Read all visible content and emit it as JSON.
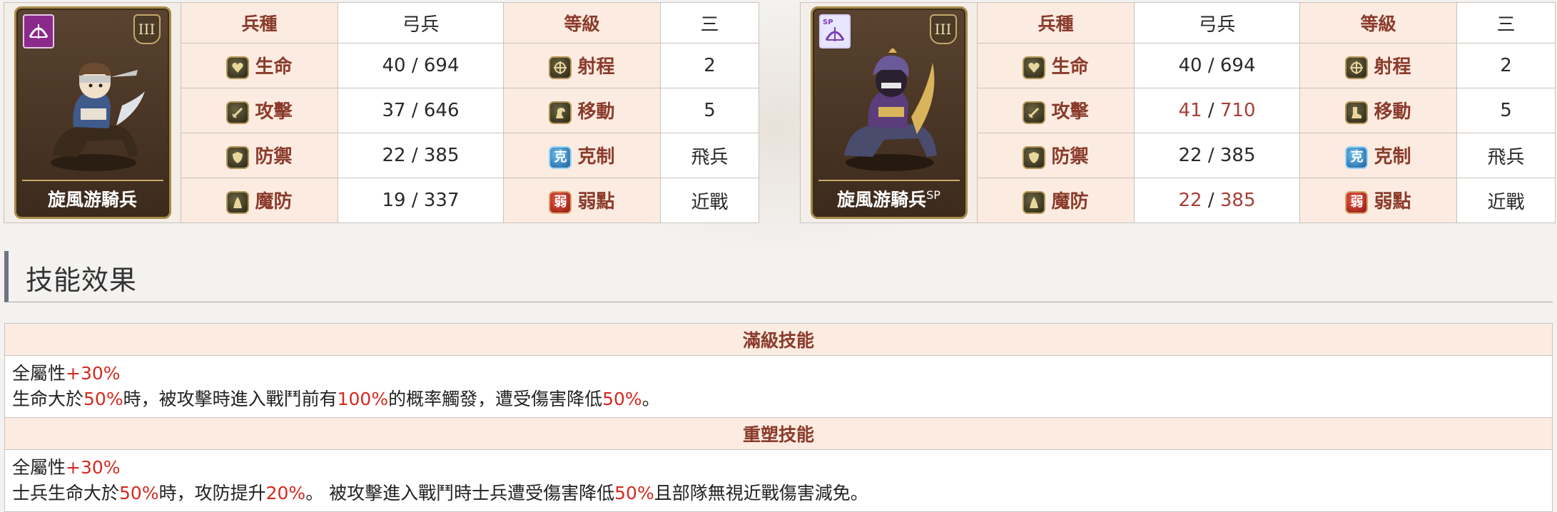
{
  "colors": {
    "header_bg": "#fcebe0",
    "header_text": "#8a3b2b",
    "highlight_red": "#d42a1f",
    "changed_value": "#a4403a"
  },
  "units": [
    {
      "name": "旋風游騎兵",
      "name_suffix": "",
      "rank": "III",
      "portrait_icon": "cavalry-archer-portrait",
      "troop_type_label": "兵種",
      "troop_type": "弓兵",
      "grade_label": "等級",
      "grade": "三",
      "stats": {
        "hp": {
          "label": "生命",
          "icon": "heart-icon",
          "base": "40",
          "max": "694",
          "changed": false
        },
        "atk": {
          "label": "攻擊",
          "icon": "sword-icon",
          "base": "37",
          "max": "646",
          "changed": false
        },
        "def": {
          "label": "防禦",
          "icon": "shield-icon",
          "base": "22",
          "max": "385",
          "changed": false
        },
        "mdef": {
          "label": "魔防",
          "icon": "cloak-icon",
          "base": "19",
          "max": "337",
          "changed": false
        }
      },
      "side": {
        "range": {
          "label": "射程",
          "icon": "crosshair-icon",
          "value": "2"
        },
        "move": {
          "label": "移動",
          "icon": "horse-icon",
          "value": "5"
        },
        "counter": {
          "label": "克制",
          "icon": "counter-icon",
          "glyph": "克",
          "value": "飛兵"
        },
        "weakness": {
          "label": "弱點",
          "icon": "weakness-icon",
          "glyph": "弱",
          "value": "近戰"
        }
      }
    },
    {
      "name": "旋風游騎兵",
      "name_suffix": "SP",
      "rank": "III",
      "portrait_icon": "sp-cavalry-archer-portrait",
      "troop_type_label": "兵種",
      "troop_type": "弓兵",
      "grade_label": "等級",
      "grade": "三",
      "stats": {
        "hp": {
          "label": "生命",
          "icon": "heart-icon",
          "base": "40",
          "max": "694",
          "changed": false
        },
        "atk": {
          "label": "攻擊",
          "icon": "sword-icon",
          "base": "41",
          "max": "710",
          "changed": true
        },
        "def": {
          "label": "防禦",
          "icon": "shield-icon",
          "base": "22",
          "max": "385",
          "changed": false
        },
        "mdef": {
          "label": "魔防",
          "icon": "cloak-icon",
          "base": "22",
          "max": "385",
          "changed": true
        }
      },
      "side": {
        "range": {
          "label": "射程",
          "icon": "crosshair-icon",
          "value": "2"
        },
        "move": {
          "label": "移動",
          "icon": "boot-icon",
          "value": "5"
        },
        "counter": {
          "label": "克制",
          "icon": "counter-icon",
          "glyph": "克",
          "value": "飛兵"
        },
        "weakness": {
          "label": "弱點",
          "icon": "weakness-icon",
          "glyph": "弱",
          "value": "近戰"
        }
      }
    }
  ],
  "skills_section": {
    "title": "技能效果",
    "blocks": [
      {
        "header": "滿級技能",
        "lines": [
          [
            {
              "t": "全屬性"
            },
            {
              "t": "+30%",
              "hl": true
            }
          ],
          [
            {
              "t": "生命大於"
            },
            {
              "t": "50%",
              "hl": true
            },
            {
              "t": "時，被攻擊時進入戰鬥前有"
            },
            {
              "t": "100%",
              "hl": true
            },
            {
              "t": "的概率觸發，遭受傷害降低"
            },
            {
              "t": "50%",
              "hl": true
            },
            {
              "t": "。"
            }
          ]
        ]
      },
      {
        "header": "重塑技能",
        "lines": [
          [
            {
              "t": "全屬性"
            },
            {
              "t": "+30%",
              "hl": true
            }
          ],
          [
            {
              "t": "士兵生命大於"
            },
            {
              "t": "50%",
              "hl": true
            },
            {
              "t": "時，攻防提升"
            },
            {
              "t": "20%",
              "hl": true
            },
            {
              "t": "。 被攻擊進入戰鬥時士兵遭受傷害降低"
            },
            {
              "t": "50%",
              "hl": true
            },
            {
              "t": "且部隊無視近戰傷害減免。"
            }
          ]
        ]
      }
    ]
  }
}
